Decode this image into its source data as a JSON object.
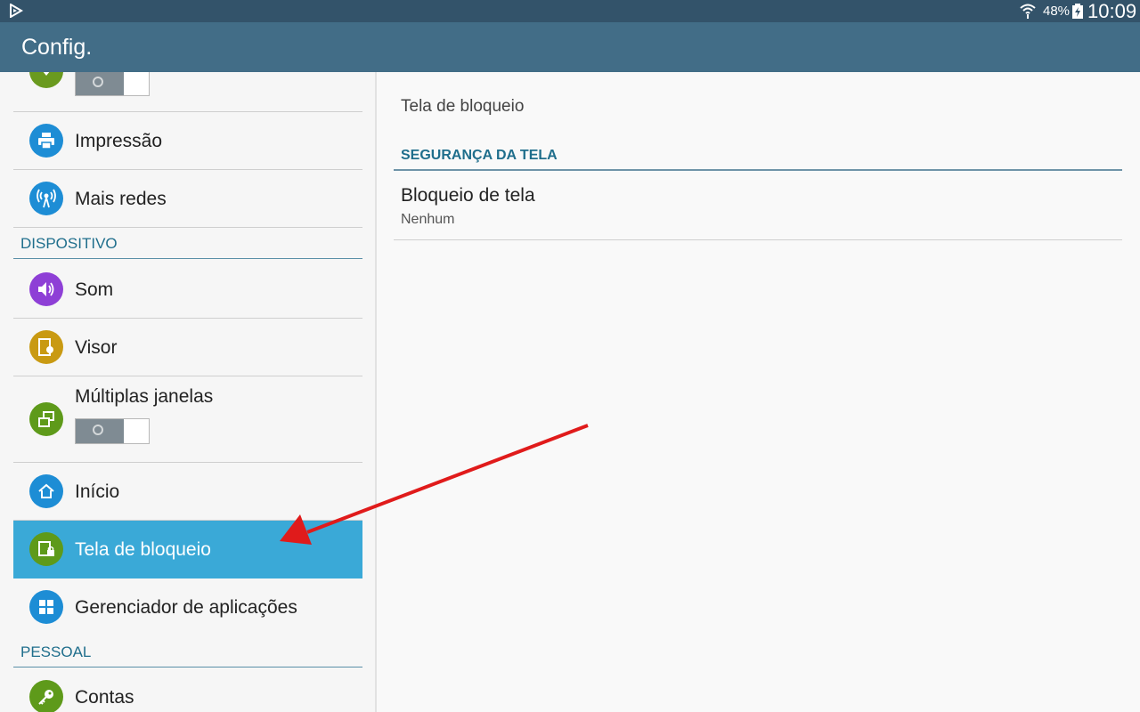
{
  "statusbar": {
    "battery_pct": "48%",
    "time": "10:09"
  },
  "app_title": "Config.",
  "sidebar": {
    "items": [
      {
        "label": "Impressão"
      },
      {
        "label": "Mais redes"
      },
      {
        "label": "Som"
      },
      {
        "label": "Visor"
      },
      {
        "label": "Múltiplas janelas"
      },
      {
        "label": "Início"
      },
      {
        "label": "Tela de bloqueio"
      },
      {
        "label": "Gerenciador de aplicações"
      },
      {
        "label": "Contas"
      }
    ],
    "sections": {
      "device": "DISPOSITIVO",
      "personal": "PESSOAL"
    }
  },
  "detail": {
    "title": "Tela de bloqueio",
    "section": "SEGURANÇA DA TELA",
    "item_title": "Bloqueio de tela",
    "item_value": "Nenhum"
  },
  "colors": {
    "accent_selected": "#3aa9d7",
    "actionbar": "#426d87",
    "statusbar": "#33536a",
    "arrow": "#e01b1b"
  }
}
